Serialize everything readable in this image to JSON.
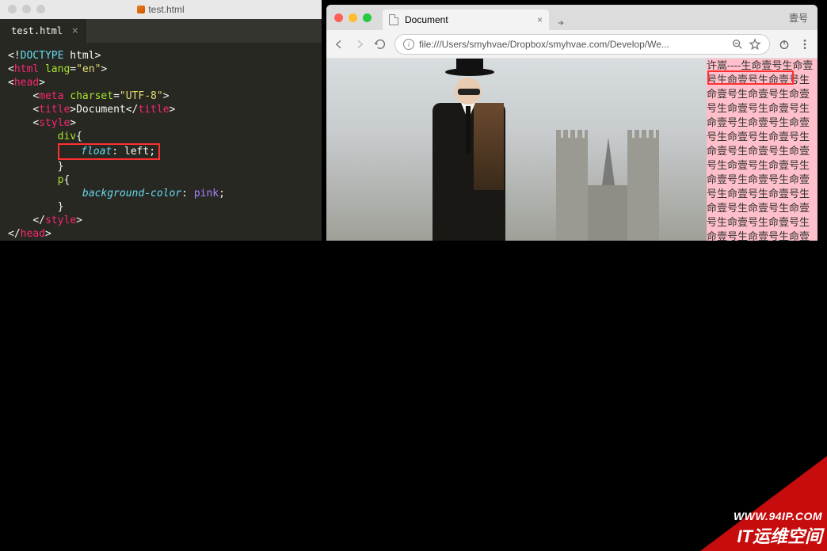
{
  "editor": {
    "window_file": "test.html",
    "tab": "test.html",
    "code": {
      "doctype": "DOCTYPE",
      "doctype_suffix": " html",
      "html_tag": "html",
      "lang_attr": "lang",
      "lang_val": "\"en\"",
      "head_tag": "head",
      "meta_tag": "meta",
      "charset_attr": "charset",
      "charset_val": "\"UTF-8\"",
      "title_tag": "title",
      "title_text": "Document",
      "style_tag": "style",
      "div_sel": "div",
      "float_prop": "float",
      "float_val": "left",
      "p_sel": "p",
      "bg_prop": "background-color",
      "bg_val": "pink",
      "brace_open": "{",
      "brace_close": "}",
      "semi": ";",
      "colon": ":"
    }
  },
  "browser": {
    "tab_title": "Document",
    "profile": "壹号",
    "url": "file:///Users/smyhvae/Dropbox/smyhvae.com/Develop/We...",
    "page_text_prefix": "许嵩----",
    "page_text_repeat": "生命壹号"
  },
  "watermark": {
    "line1": "WWW.94IP.COM",
    "line2": "IT运维空间"
  },
  "colors": {
    "editor_bg": "#272822",
    "pink": "#ffc0cb",
    "highlight_red": "#ff3030",
    "watermark_red": "#c60c0c"
  }
}
